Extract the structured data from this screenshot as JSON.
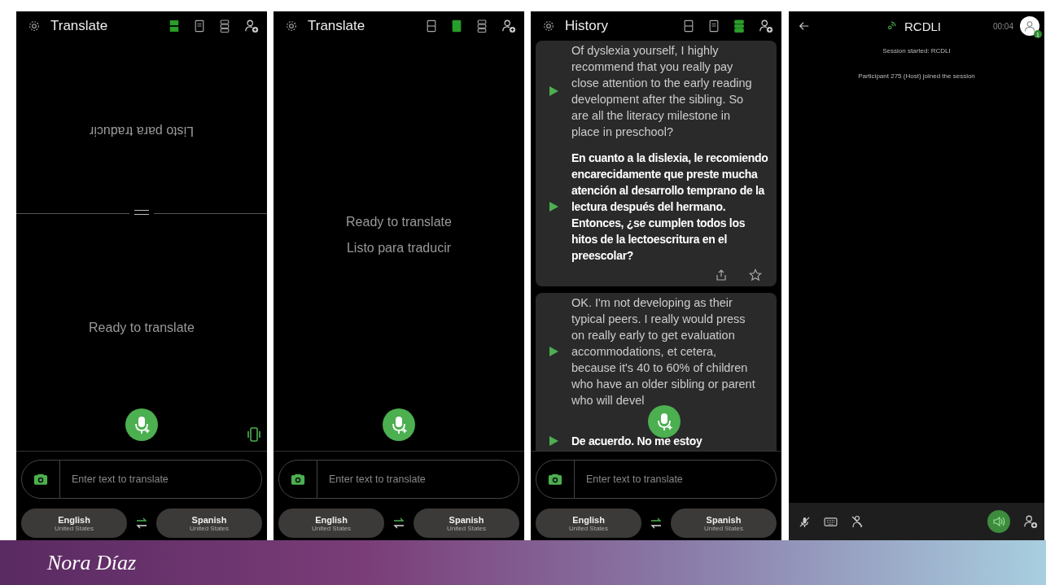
{
  "panels": [
    {
      "kind": "split",
      "title": "Translate",
      "view_modes": [
        {
          "kind": "split",
          "selected": true
        },
        {
          "kind": "document",
          "selected": false
        },
        {
          "kind": "stacked",
          "selected": false
        }
      ],
      "top_text": "Listo para traducir",
      "bottom_text": "Ready to translate",
      "vibrate_indicator": true,
      "placeholder": "Enter text to translate",
      "languages": [
        {
          "name": "English",
          "region": "United States"
        },
        {
          "name": "Spanish",
          "region": "United States"
        }
      ]
    },
    {
      "kind": "dual",
      "title": "Translate",
      "view_modes": [
        {
          "kind": "split",
          "selected": false
        },
        {
          "kind": "document",
          "selected": true
        },
        {
          "kind": "stacked",
          "selected": false
        }
      ],
      "lines": [
        "Ready to translate",
        "Listo para traducir"
      ],
      "placeholder": "Enter text to translate",
      "languages": [
        {
          "name": "English",
          "region": "United States"
        },
        {
          "name": "Spanish",
          "region": "United States"
        }
      ]
    },
    {
      "kind": "history",
      "title": "History",
      "view_modes": [
        {
          "kind": "split",
          "selected": false
        },
        {
          "kind": "document",
          "selected": false
        },
        {
          "kind": "stacked",
          "selected": true
        }
      ],
      "cards": [
        {
          "paragraphs": [
            {
              "text": "Of dyslexia yourself, I highly recommend that you really pay close attention to the early reading development after the sibling. So are all the literacy milestone in place in preschool?",
              "bold": false
            },
            {
              "text": "En cuanto a la dislexia, le recomiendo encarecidamente que preste mucha atención al desarrollo temprano de la lectura después del hermano. Entonces, ¿se cumplen todos los hitos de la lectoescritura en el preescolar?",
              "bold": true
            }
          ],
          "actions": true
        },
        {
          "paragraphs": [
            {
              "text": "OK. I'm not developing as their typical peers. I really would press on really early to get evaluation accommodations, et cetera, because it's 40 to 60% of children who have an older sibling or parent who will devel",
              "bold": false
            },
            {
              "text": "De acuerdo. No me estoy",
              "bold": true
            }
          ],
          "actions": false
        }
      ],
      "placeholder": "Enter text to translate",
      "languages": [
        {
          "name": "English",
          "region": "United States"
        },
        {
          "name": "Spanish",
          "region": "United States"
        }
      ]
    },
    {
      "kind": "session",
      "title": "RCDLI",
      "timer": "00:04",
      "badge": "1",
      "messages": [
        "Session started: RCDLI",
        "Participant 275 (Host) joined the session"
      ],
      "speaker_on": true
    }
  ],
  "banner": {
    "name": "Nora Díaz"
  }
}
